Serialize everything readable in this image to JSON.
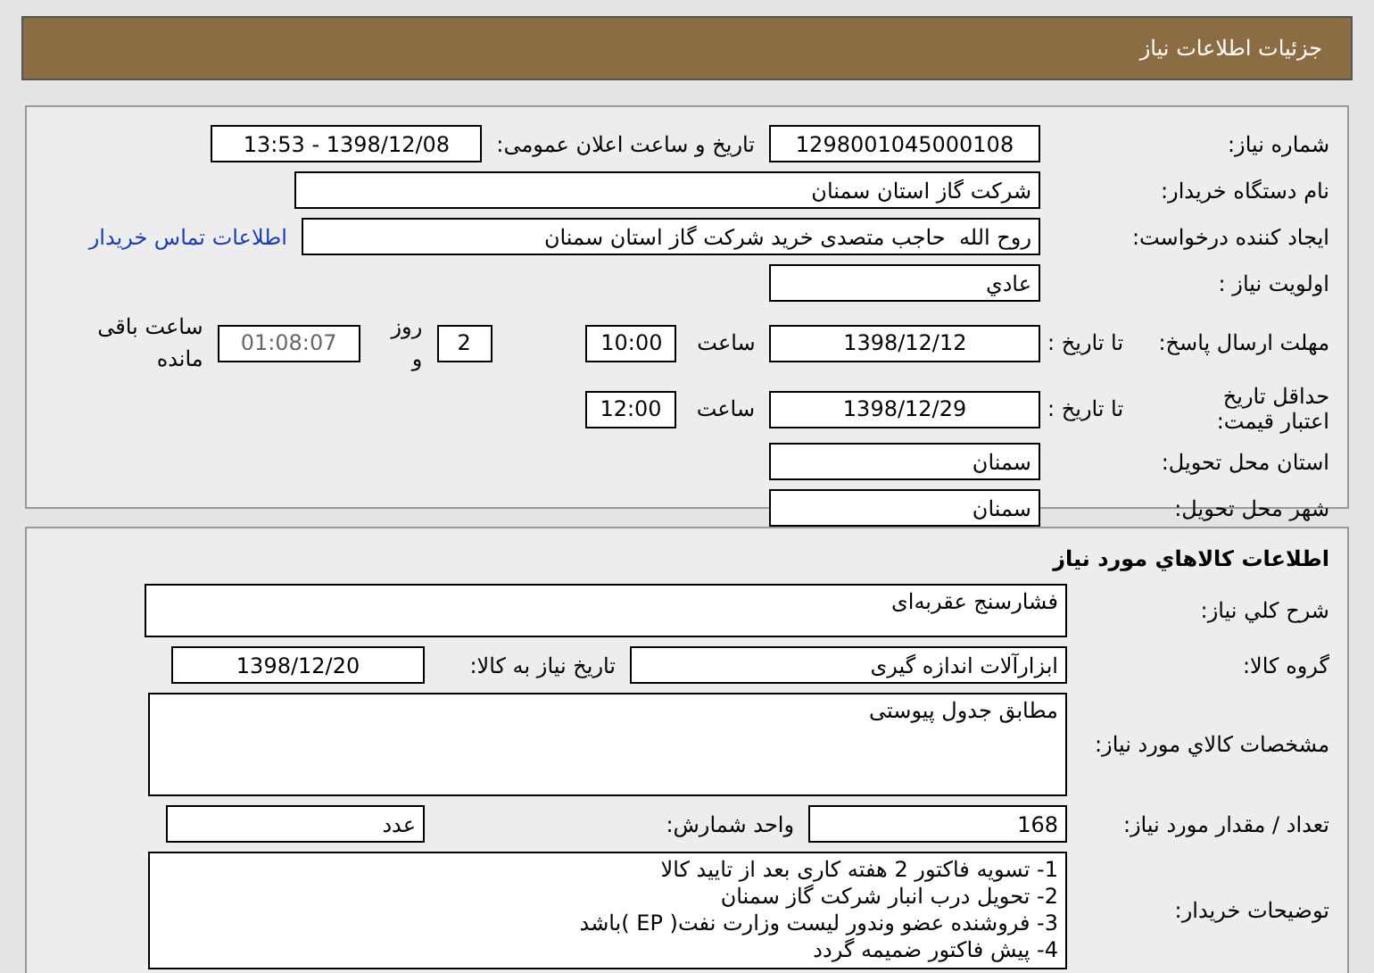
{
  "header": {
    "title": "جزئیات اطلاعات نیاز"
  },
  "need_details": {
    "need_number": {
      "label": "شماره نیاز:",
      "value": "1298001045000108"
    },
    "announce_datetime": {
      "label": "تاریخ و ساعت اعلان عمومی:",
      "value": "1398/12/08 - 13:53"
    },
    "buyer_org": {
      "label": "نام دستگاه خریدار:",
      "value": "شرکت گاز استان سمنان"
    },
    "requester": {
      "label": "ایجاد کننده درخواست:",
      "value": "روح الله  حاجب متصدی خرید شرکت گاز استان سمنان"
    },
    "contact_link": "اطلاعات تماس خریدار",
    "priority": {
      "label": "اولویت نیاز :",
      "value": "عادي"
    },
    "response_deadline": {
      "label": "مهلت ارسال پاسخ:",
      "to_date_label": "تا تاریخ :",
      "date": "1398/12/12",
      "time_label": "ساعت",
      "time": "10:00",
      "days": "2",
      "days_label": "روز و",
      "remaining": "01:08:07",
      "remaining_label": "ساعت باقی مانده"
    },
    "price_validity": {
      "label": "حداقل تاریخ اعتبار قیمت:",
      "to_date_label": "تا تاریخ :",
      "date": "1398/12/29",
      "time_label": "ساعت",
      "time": "12:00"
    },
    "delivery_province": {
      "label": "استان محل تحویل:",
      "value": "سمنان"
    },
    "delivery_city": {
      "label": "شهر محل تحویل:",
      "value": "سمنان"
    }
  },
  "goods": {
    "title": "اطلاعات کالاهاي مورد نیاز",
    "summary": {
      "label": "شرح کلي نیاز:",
      "value": "فشارسنج عقربه‌ای"
    },
    "group": {
      "label": "گروه کالا:",
      "value": "ابزارآلات اندازه گیری"
    },
    "need_date": {
      "label": "تاریخ نیاز به کالا:",
      "value": "1398/12/20"
    },
    "specs": {
      "label": "مشخصات کالاي مورد نیاز:",
      "value": "مطابق جدول پیوستی"
    },
    "quantity": {
      "label": "تعداد / مقدار مورد نیاز:",
      "value": "168"
    },
    "unit": {
      "label": "واحد شمارش:",
      "value": "عدد"
    },
    "buyer_notes": {
      "label": "توضیحات خریدار:",
      "lines": [
        "1- تسویه فاکتور 2 هفته کاری بعد از تایید کالا",
        "2- تحویل درب انبار شرکت گاز سمنان",
        "3- فروشنده عضو وندور لیست وزارت نفت( EP )باشد",
        "4- پیش فاکتور ضمیمه گردد"
      ]
    }
  }
}
